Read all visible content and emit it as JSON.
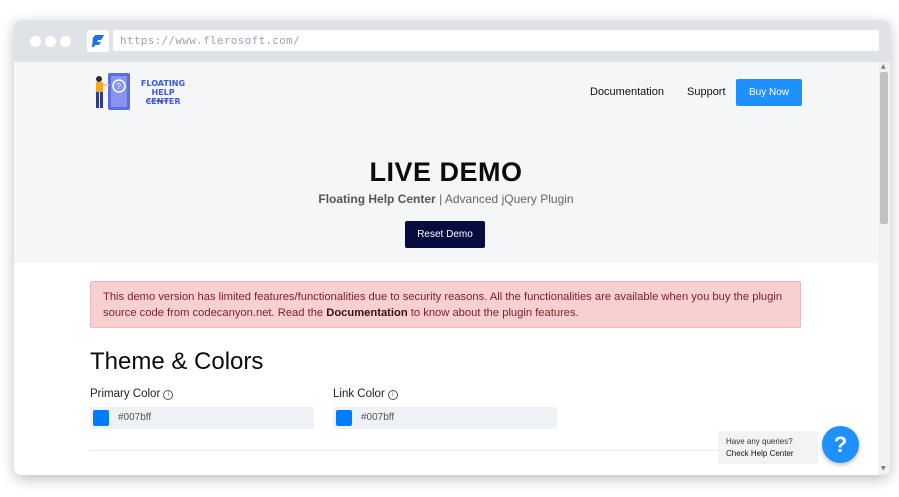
{
  "browser": {
    "url": "https://www.flerosoft.com/"
  },
  "header": {
    "logo_title": "FLOATING HELP CENTER",
    "logo_by": "By Flerosoft",
    "nav": [
      "Documentation",
      "Support"
    ],
    "buy_label": "Buy Now"
  },
  "hero": {
    "title": "LIVE DEMO",
    "subtitle_bold": "Floating Help Center",
    "subtitle_sep": " | ",
    "subtitle_rest": "Advanced jQuery Plugin",
    "reset_label": "Reset Demo"
  },
  "alert": {
    "text_before": "This demo version has limited features/functionalities due to security reasons. All the functionalities are available when you buy the plugin source code from codecanyon.net. Read the ",
    "link": "Documentation",
    "text_after": " to know about the plugin features."
  },
  "theme": {
    "title": "Theme & Colors",
    "primary_label": "Primary Color",
    "primary_value": "#007bff",
    "link_label": "Link Color",
    "link_value": "#007bff"
  },
  "help": {
    "line1": "Have any queries?",
    "line2": "Check Help Center",
    "button": "?"
  },
  "colors": {
    "accent": "#1e90ff",
    "swatch": "#007bff",
    "dark_button": "#070c3e",
    "alert_bg": "#f8d0d2"
  }
}
